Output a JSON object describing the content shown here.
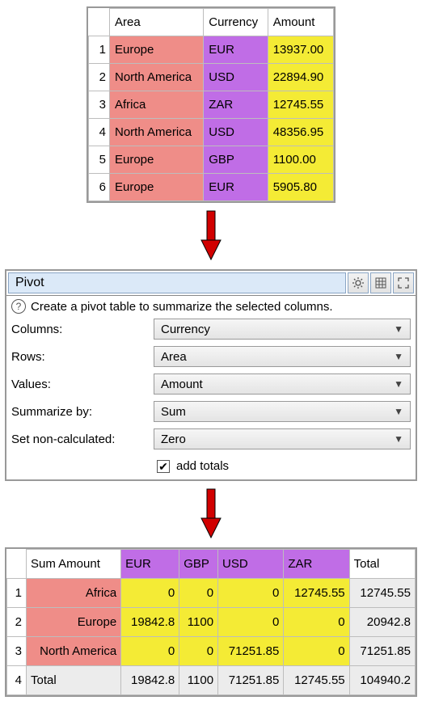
{
  "source": {
    "headers": {
      "area": "Area",
      "currency": "Currency",
      "amount": "Amount"
    },
    "rows": [
      {
        "area": "Europe",
        "currency": "EUR",
        "amount": "13937.00"
      },
      {
        "area": "North America",
        "currency": "USD",
        "amount": "22894.90"
      },
      {
        "area": "Africa",
        "currency": "ZAR",
        "amount": "12745.55"
      },
      {
        "area": "North America",
        "currency": "USD",
        "amount": "48356.95"
      },
      {
        "area": "Europe",
        "currency": "GBP",
        "amount": "1100.00"
      },
      {
        "area": "Europe",
        "currency": "EUR",
        "amount": "5905.80"
      }
    ]
  },
  "panel": {
    "title": "Pivot",
    "hint": "Create a pivot table to summarize the selected columns.",
    "labels": {
      "columns": "Columns:",
      "rows": "Rows:",
      "values": "Values:",
      "summarize": "Summarize by:",
      "noncalc": "Set non-calculated:"
    },
    "values": {
      "columns": "Currency",
      "rows": "Area",
      "values": "Amount",
      "summarize": "Sum",
      "noncalc": "Zero"
    },
    "add_totals_label": "add totals",
    "add_totals_checked": true
  },
  "result": {
    "corner": "Sum Amount",
    "col_headers": [
      "EUR",
      "GBP",
      "USD",
      "ZAR"
    ],
    "total_label": "Total",
    "rows": [
      {
        "area": "Africa",
        "vals": [
          "0",
          "0",
          "0",
          "12745.55"
        ],
        "total": "12745.55"
      },
      {
        "area": "Europe",
        "vals": [
          "19842.8",
          "1100",
          "0",
          "0"
        ],
        "total": "20942.8"
      },
      {
        "area": "North America",
        "vals": [
          "0",
          "0",
          "71251.85",
          "0"
        ],
        "total": "71251.85"
      }
    ],
    "totals": {
      "vals": [
        "19842.8",
        "1100",
        "71251.85",
        "12745.55"
      ],
      "grand": "104940.2"
    }
  }
}
